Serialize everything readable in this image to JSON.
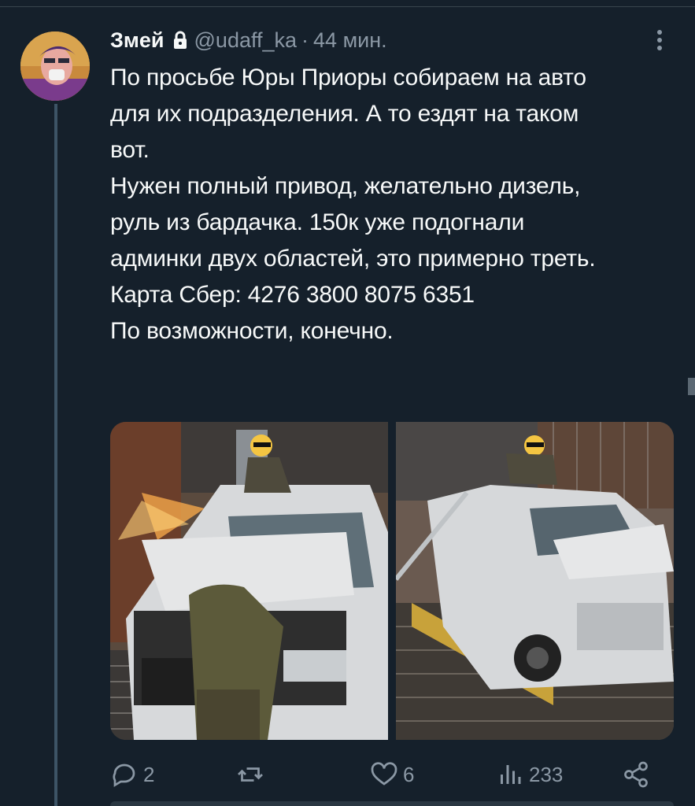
{
  "tweet": {
    "display_name": "Змей",
    "handle": "@udaff_ka",
    "separator": "·",
    "time": "44 мин.",
    "text_lines": [
      "По просьбе Юры Приоры собираем на авто",
      "для их подразделения. А то ездят на таком",
      "вот.",
      "Нужен полный привод, желательно дизель,",
      "руль из бардачка. 150к уже подогнали",
      "админки двух областей, это примерно треть.",
      "",
      "Карта Сбер: 4276 3800 8075 6351",
      "",
      "По возможности, конечно."
    ]
  },
  "actions": {
    "replies": "2",
    "retweets": "",
    "likes": "6",
    "views": "233"
  },
  "icons": {
    "lock": "lock-icon",
    "more": "more-vertical-icon",
    "reply": "reply-icon",
    "retweet": "retweet-icon",
    "like": "heart-icon",
    "views": "views-icon",
    "share": "share-icon"
  },
  "colors": {
    "background": "#15202b",
    "text": "#f7f9f9",
    "secondary": "#8b98a5",
    "thread_line": "#3d5466"
  }
}
